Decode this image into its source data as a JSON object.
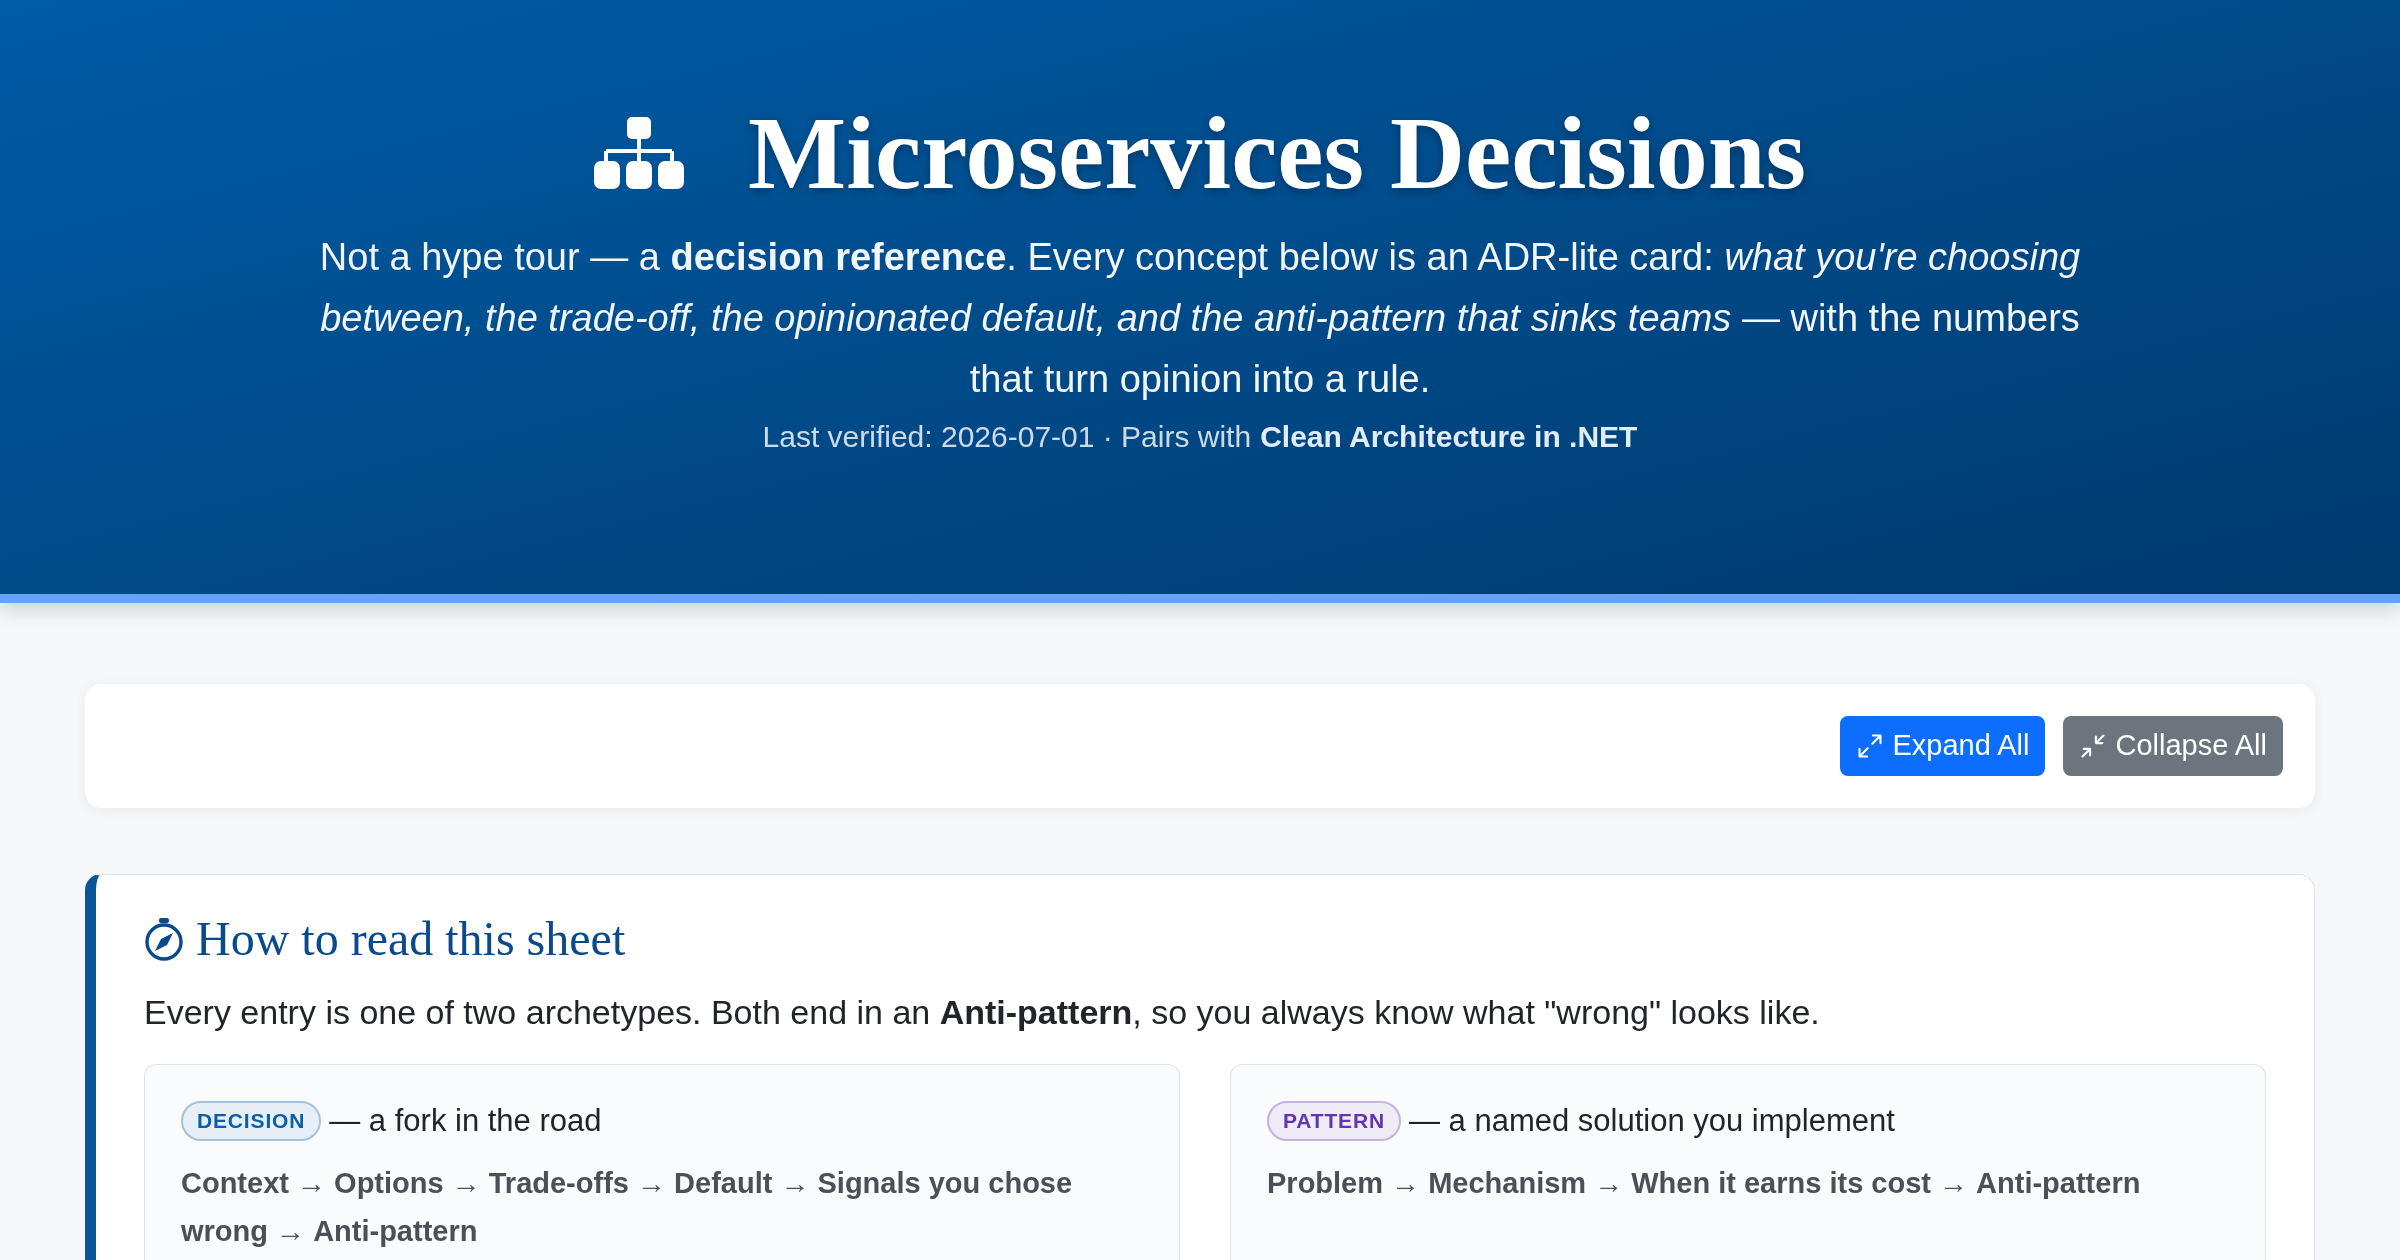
{
  "header": {
    "title": "Microservices Decisions",
    "subtitle": "Not a hype tour — a **decision reference**. Every concept below is an ADR-lite card: *what you're choosing between, the trade-off, the opinionated default, and the anti-pattern that sinks teams* — with the numbers that turn opinion into a rule.",
    "meta": {
      "text": "Last verified: 2026-07-01 · Pairs with",
      "link": "Clean Architecture in .NET"
    }
  },
  "toolbar": {
    "buttons": [
      {
        "label": "Expand All",
        "kind": "expand"
      },
      {
        "label": "Collapse All",
        "kind": "collapse"
      }
    ]
  },
  "guide": {
    "title": "How to read this sheet",
    "intro": "Every entry is one of two archetypes. Both end in an **Anti-pattern**, so you always know what \"wrong\" looks like.",
    "archetypes": [
      {
        "badge": "DECISION",
        "color": "#0b5ea8",
        "description": "— a fork in the road",
        "flow": "**Context** → **Options** → **Trade-offs** → **Default** → **Signals you chose wrong** → **Anti-pattern**"
      },
      {
        "badge": "PATTERN",
        "color": "#6334b0",
        "description": "— a named solution you implement",
        "flow": "**Problem** → **Mechanism** → **When it earns its cost** → **Anti-pattern**"
      }
    ]
  }
}
